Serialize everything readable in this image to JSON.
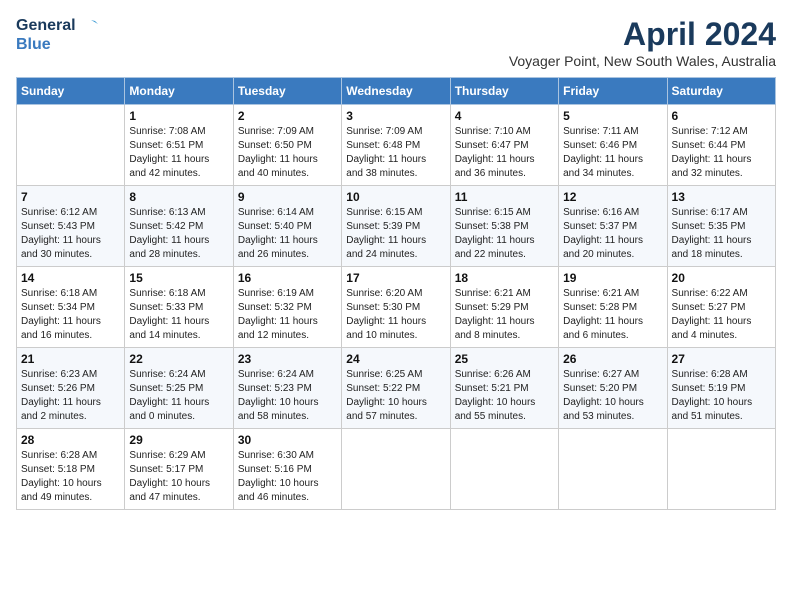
{
  "header": {
    "logo_line1": "General",
    "logo_line2": "Blue",
    "month_title": "April 2024",
    "subtitle": "Voyager Point, New South Wales, Australia"
  },
  "days_of_week": [
    "Sunday",
    "Monday",
    "Tuesday",
    "Wednesday",
    "Thursday",
    "Friday",
    "Saturday"
  ],
  "weeks": [
    [
      {
        "day": "",
        "info": ""
      },
      {
        "day": "1",
        "info": "Sunrise: 7:08 AM\nSunset: 6:51 PM\nDaylight: 11 hours\nand 42 minutes."
      },
      {
        "day": "2",
        "info": "Sunrise: 7:09 AM\nSunset: 6:50 PM\nDaylight: 11 hours\nand 40 minutes."
      },
      {
        "day": "3",
        "info": "Sunrise: 7:09 AM\nSunset: 6:48 PM\nDaylight: 11 hours\nand 38 minutes."
      },
      {
        "day": "4",
        "info": "Sunrise: 7:10 AM\nSunset: 6:47 PM\nDaylight: 11 hours\nand 36 minutes."
      },
      {
        "day": "5",
        "info": "Sunrise: 7:11 AM\nSunset: 6:46 PM\nDaylight: 11 hours\nand 34 minutes."
      },
      {
        "day": "6",
        "info": "Sunrise: 7:12 AM\nSunset: 6:44 PM\nDaylight: 11 hours\nand 32 minutes."
      }
    ],
    [
      {
        "day": "7",
        "info": "Sunrise: 6:12 AM\nSunset: 5:43 PM\nDaylight: 11 hours\nand 30 minutes."
      },
      {
        "day": "8",
        "info": "Sunrise: 6:13 AM\nSunset: 5:42 PM\nDaylight: 11 hours\nand 28 minutes."
      },
      {
        "day": "9",
        "info": "Sunrise: 6:14 AM\nSunset: 5:40 PM\nDaylight: 11 hours\nand 26 minutes."
      },
      {
        "day": "10",
        "info": "Sunrise: 6:15 AM\nSunset: 5:39 PM\nDaylight: 11 hours\nand 24 minutes."
      },
      {
        "day": "11",
        "info": "Sunrise: 6:15 AM\nSunset: 5:38 PM\nDaylight: 11 hours\nand 22 minutes."
      },
      {
        "day": "12",
        "info": "Sunrise: 6:16 AM\nSunset: 5:37 PM\nDaylight: 11 hours\nand 20 minutes."
      },
      {
        "day": "13",
        "info": "Sunrise: 6:17 AM\nSunset: 5:35 PM\nDaylight: 11 hours\nand 18 minutes."
      }
    ],
    [
      {
        "day": "14",
        "info": "Sunrise: 6:18 AM\nSunset: 5:34 PM\nDaylight: 11 hours\nand 16 minutes."
      },
      {
        "day": "15",
        "info": "Sunrise: 6:18 AM\nSunset: 5:33 PM\nDaylight: 11 hours\nand 14 minutes."
      },
      {
        "day": "16",
        "info": "Sunrise: 6:19 AM\nSunset: 5:32 PM\nDaylight: 11 hours\nand 12 minutes."
      },
      {
        "day": "17",
        "info": "Sunrise: 6:20 AM\nSunset: 5:30 PM\nDaylight: 11 hours\nand 10 minutes."
      },
      {
        "day": "18",
        "info": "Sunrise: 6:21 AM\nSunset: 5:29 PM\nDaylight: 11 hours\nand 8 minutes."
      },
      {
        "day": "19",
        "info": "Sunrise: 6:21 AM\nSunset: 5:28 PM\nDaylight: 11 hours\nand 6 minutes."
      },
      {
        "day": "20",
        "info": "Sunrise: 6:22 AM\nSunset: 5:27 PM\nDaylight: 11 hours\nand 4 minutes."
      }
    ],
    [
      {
        "day": "21",
        "info": "Sunrise: 6:23 AM\nSunset: 5:26 PM\nDaylight: 11 hours\nand 2 minutes."
      },
      {
        "day": "22",
        "info": "Sunrise: 6:24 AM\nSunset: 5:25 PM\nDaylight: 11 hours\nand 0 minutes."
      },
      {
        "day": "23",
        "info": "Sunrise: 6:24 AM\nSunset: 5:23 PM\nDaylight: 10 hours\nand 58 minutes."
      },
      {
        "day": "24",
        "info": "Sunrise: 6:25 AM\nSunset: 5:22 PM\nDaylight: 10 hours\nand 57 minutes."
      },
      {
        "day": "25",
        "info": "Sunrise: 6:26 AM\nSunset: 5:21 PM\nDaylight: 10 hours\nand 55 minutes."
      },
      {
        "day": "26",
        "info": "Sunrise: 6:27 AM\nSunset: 5:20 PM\nDaylight: 10 hours\nand 53 minutes."
      },
      {
        "day": "27",
        "info": "Sunrise: 6:28 AM\nSunset: 5:19 PM\nDaylight: 10 hours\nand 51 minutes."
      }
    ],
    [
      {
        "day": "28",
        "info": "Sunrise: 6:28 AM\nSunset: 5:18 PM\nDaylight: 10 hours\nand 49 minutes."
      },
      {
        "day": "29",
        "info": "Sunrise: 6:29 AM\nSunset: 5:17 PM\nDaylight: 10 hours\nand 47 minutes."
      },
      {
        "day": "30",
        "info": "Sunrise: 6:30 AM\nSunset: 5:16 PM\nDaylight: 10 hours\nand 46 minutes."
      },
      {
        "day": "",
        "info": ""
      },
      {
        "day": "",
        "info": ""
      },
      {
        "day": "",
        "info": ""
      },
      {
        "day": "",
        "info": ""
      }
    ]
  ]
}
